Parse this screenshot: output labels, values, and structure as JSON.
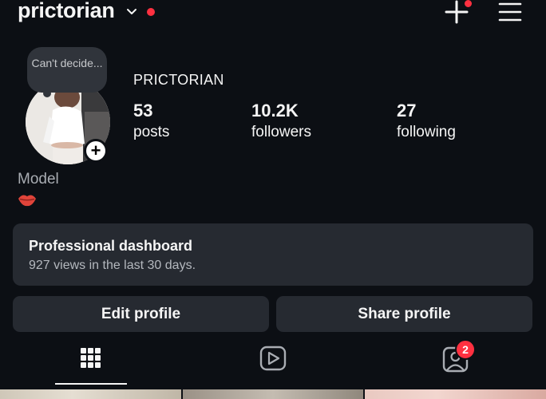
{
  "header": {
    "username": "prictorian",
    "accent_color": "#ff3040"
  },
  "profile": {
    "note": "Can't decide...",
    "display_name": "PRICTORIAN",
    "stats": [
      {
        "num": "53",
        "label": "posts"
      },
      {
        "num": "10.2K",
        "label": "followers"
      },
      {
        "num": "27",
        "label": "following"
      }
    ],
    "category": "Model",
    "bio_emoji": "lips-icon"
  },
  "dashboard": {
    "title": "Professional dashboard",
    "subtitle": "927 views in the last 30 days."
  },
  "buttons": {
    "edit": "Edit profile",
    "share": "Share profile"
  },
  "tabs": {
    "active": "grid",
    "tagged_badge": "2"
  }
}
